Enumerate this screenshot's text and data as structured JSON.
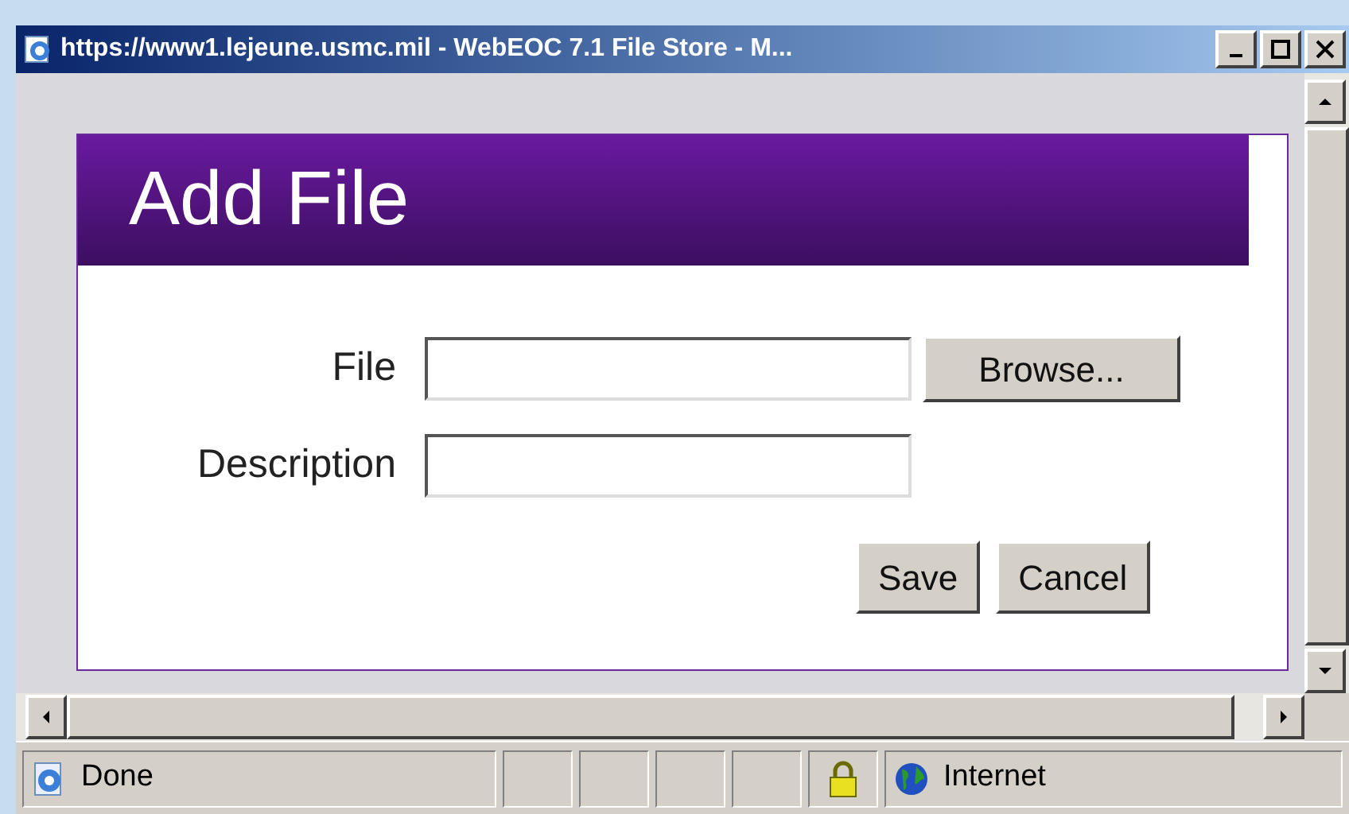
{
  "window": {
    "title": "https://www1.lejeune.usmc.mil - WebEOC 7.1  File Store - M..."
  },
  "form": {
    "heading": "Add File",
    "fields": [
      {
        "label": "File",
        "kind": "file",
        "button": "Browse..."
      },
      {
        "label": "Description",
        "kind": "text"
      }
    ],
    "buttons": [
      "Save",
      "Cancel"
    ]
  },
  "status_bar": {
    "status": "Done",
    "zone": "Internet"
  }
}
